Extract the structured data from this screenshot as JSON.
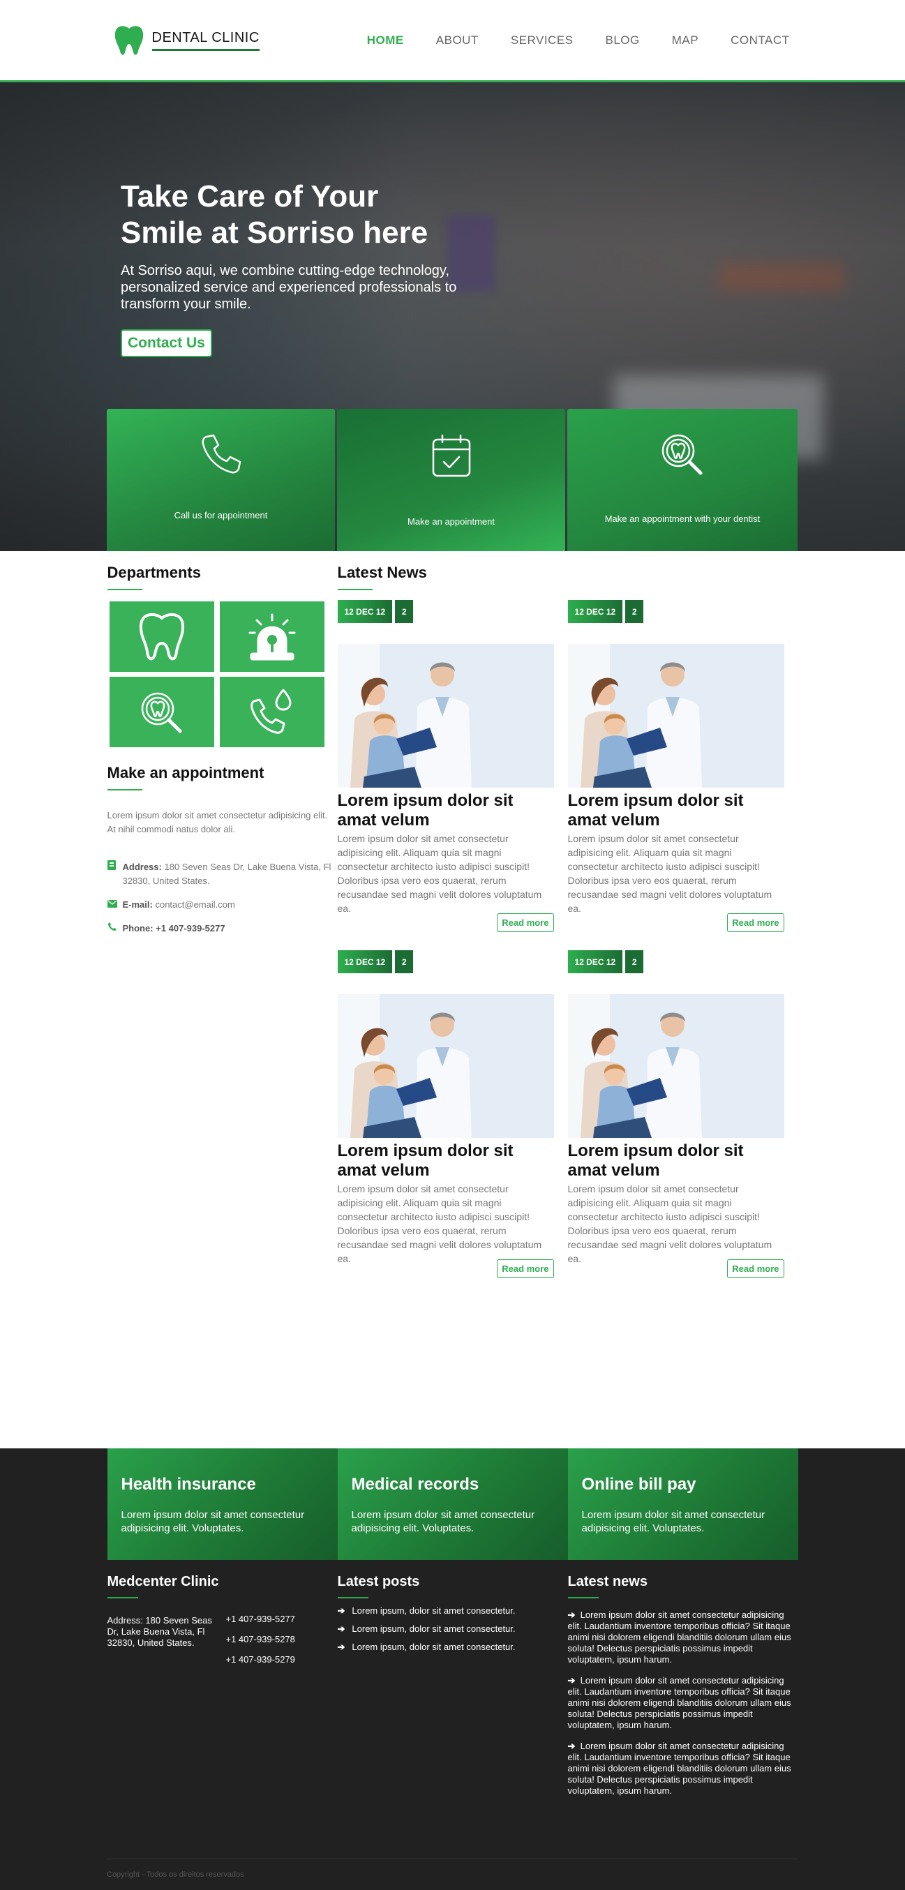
{
  "header": {
    "logo_text": "DENTAL CLINIC",
    "nav": [
      {
        "label": "HOME",
        "active": true
      },
      {
        "label": "ABOUT"
      },
      {
        "label": "SERVICES"
      },
      {
        "label": "BLOG"
      },
      {
        "label": "MAP"
      },
      {
        "label": "CONTACT"
      }
    ]
  },
  "hero": {
    "title_line1": "Take Care of Your",
    "title_line2": "Smile at Sorriso here",
    "text": "At Sorriso aqui, we combine cutting-edge technology, personalized service and experienced professionals to transform your smile.",
    "cta_label": "Contact Us"
  },
  "features": [
    {
      "label": "Call us for appointment",
      "icon": "phone-icon"
    },
    {
      "label": "Make an appointment",
      "icon": "calendar-check-icon"
    },
    {
      "label": "Make an appointment with your dentist",
      "icon": "tooth-search-icon"
    }
  ],
  "departments": {
    "title": "Departments",
    "items": [
      "tooth-icon",
      "emergency-light-icon",
      "tooth-search-icon",
      "phone-drop-icon"
    ]
  },
  "appointment": {
    "title": "Make an appointment",
    "text": "Lorem ipsum dolor sit amet consectetur adipisicing elit. At nihil commodi natus dolor ali.",
    "address_label": "Address:",
    "address_value": "180 Seven Seas Dr, Lake Buena Vista, Fl 32830, United States.",
    "email_label": "E-mail:",
    "email_value": "contact@email.com",
    "phone_label": "Phone:",
    "phone_value": "+1 407-939-5277"
  },
  "news": {
    "title": "Latest News",
    "items": [
      {
        "date": "12 DEC 12",
        "count": "2",
        "title": "Lorem ipsum dolor sit amat velum",
        "text": "Lorem ipsum dolor sit amet consectetur adipisicing elit. Aliquam quia sit magni consectetur architecto iusto adipisci suscipit! Doloribus ipsa vero eos quaerat, rerum recusandae sed magni velit dolores voluptatum ea.",
        "cta": "Read more"
      },
      {
        "date": "12 DEC 12",
        "count": "2",
        "title": "Lorem ipsum dolor sit amat velum",
        "text": "Lorem ipsum dolor sit amet consectetur adipisicing elit. Aliquam quia sit magni consectetur architecto iusto adipisci suscipit! Doloribus ipsa vero eos quaerat, rerum recusandae sed magni velit dolores voluptatum ea.",
        "cta": "Read more"
      },
      {
        "date": "12 DEC 12",
        "count": "2",
        "title": "Lorem ipsum dolor sit amat velum",
        "text": "Lorem ipsum dolor sit amet consectetur adipisicing elit. Aliquam quia sit magni consectetur architecto iusto adipisci suscipit! Doloribus ipsa vero eos quaerat, rerum recusandae sed magni velit dolores voluptatum ea.",
        "cta": "Read more"
      },
      {
        "date": "12 DEC 12",
        "count": "2",
        "title": "Lorem ipsum dolor sit amat velum",
        "text": "Lorem ipsum dolor sit amet consectetur adipisicing elit. Aliquam quia sit magni consectetur architecto iusto adipisci suscipit! Doloribus ipsa vero eos quaerat, rerum recusandae sed magni velit dolores voluptatum ea.",
        "cta": "Read more"
      }
    ]
  },
  "footer": {
    "cards": [
      {
        "title": "Health insurance",
        "text": "Lorem ipsum dolor sit amet consectetur adipisicing elit. Voluptates."
      },
      {
        "title": "Medical records",
        "text": "Lorem ipsum dolor sit amet consectetur adipisicing elit. Voluptates."
      },
      {
        "title": "Online bill pay",
        "text": "Lorem ipsum dolor sit amet consectetur adipisicing elit. Voluptates."
      }
    ],
    "clinic": {
      "title": "Medcenter Clinic",
      "address": "Address: 180 Seven Seas Dr, Lake Buena Vista, Fl 32830, United States.",
      "phones": [
        "+1 407-939-5277",
        "+1 407-939-5278",
        "+1 407-939-5279"
      ]
    },
    "posts": {
      "title": "Latest posts",
      "items": [
        "Lorem ipsum, dolor sit amet consectetur.",
        "Lorem ipsum, dolor sit amet consectetur.",
        "Lorem ipsum, dolor sit amet consectetur."
      ]
    },
    "news": {
      "title": "Latest news",
      "items": [
        "Lorem ipsum dolor sit amet consectetur adipisicing elit. Laudantium inventore temporibus officia? Sit itaque animi nisi dolorem eligendi blanditiis dolorum ullam eius soluta! Delectus perspiciatis possimus impedit voluptatem, ipsum harum.",
        "Lorem ipsum dolor sit amet consectetur adipisicing elit. Laudantium inventore temporibus officia? Sit itaque animi nisi dolorem eligendi blanditiis dolorum ullam eius soluta! Delectus perspiciatis possimus impedit voluptatem, ipsum harum.",
        "Lorem ipsum dolor sit amet consectetur adipisicing elit. Laudantium inventore temporibus officia? Sit itaque animi nisi dolorem eligendi blanditiis dolorum ullam eius soluta! Delectus perspiciatis possimus impedit voluptatem, ipsum harum."
      ]
    },
    "copyright": "Copyright - Todos os direitos reservados"
  },
  "colors": {
    "accent": "#2eae4f",
    "accent_dark": "#1b6c32",
    "footer_bg": "#212121"
  }
}
